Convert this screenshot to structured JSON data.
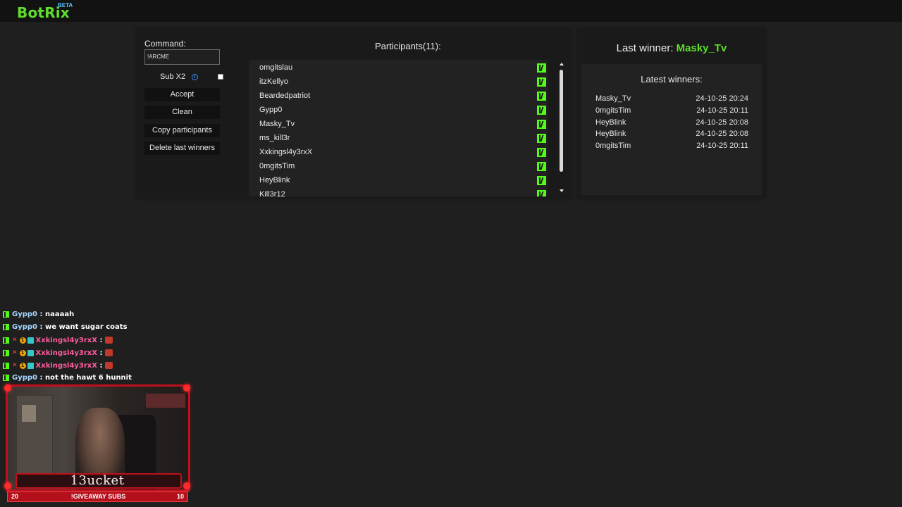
{
  "app": {
    "logo": "BotRix",
    "badge": "BETA"
  },
  "command": {
    "label": "Command:",
    "value": "!ARCME"
  },
  "sub_option": {
    "label": "Sub X2",
    "info_icon": "info-icon",
    "checked": false
  },
  "buttons": {
    "accept": "Accept",
    "clean": "Clean",
    "copy": "Copy participants",
    "delete": "Delete last winners"
  },
  "participants": {
    "title": "Participants(11):",
    "items": [
      "omgitslau",
      "itzKellyo",
      "Beardedpatriot",
      "Gypp0",
      "Masky_Tv",
      "ms_kill3r",
      "Xxkingsl4y3rxX",
      "0mgitsTim",
      "HeyBlink",
      "Kill3r12"
    ],
    "platform_icon": "kick-icon"
  },
  "last_winner": {
    "label": "Last winner:",
    "name": "Masky_Tv"
  },
  "latest_winners": {
    "title": "Latest winners:",
    "rows": [
      {
        "name": "Masky_Tv",
        "date": "24-10-25 20:24"
      },
      {
        "name": "0mgitsTim",
        "date": "24-10-25 20:11"
      },
      {
        "name": "HeyBlink",
        "date": "24-10-25 20:08"
      },
      {
        "name": "HeyBlink",
        "date": "24-10-25 20:08"
      },
      {
        "name": "0mgitsTim",
        "date": "24-10-25 20:11"
      }
    ]
  },
  "chat": [
    {
      "user": "Gypp0",
      "message": ": naaaah"
    },
    {
      "user": "Gypp0",
      "message": ": we want sugar coats"
    },
    {
      "user": "Xxkingsl4y3rxX",
      "message": ":"
    },
    {
      "user": "Xxkingsl4y3rxX",
      "message": ":"
    },
    {
      "user": "Xxkingsl4y3rxX",
      "message": ":"
    },
    {
      "user": "Gypp0",
      "message": ": not the hawt 6 hunnit"
    }
  ],
  "stream": {
    "streamer_name": "13ucket",
    "goal": {
      "current": "20",
      "label": "!GIVEAWAY SUBS",
      "target": "10"
    }
  },
  "colors": {
    "brand_green": "#5fdd2c",
    "kick_green": "#53fc18",
    "overlay_red": "#c0101c"
  }
}
